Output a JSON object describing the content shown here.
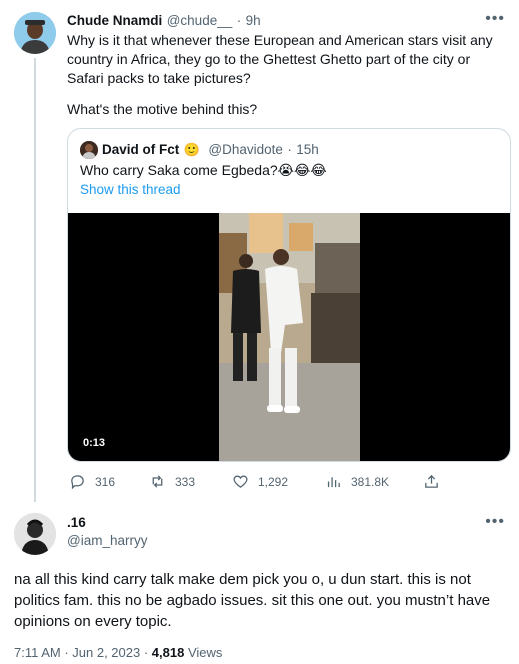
{
  "main_tweet": {
    "author_name": "Chude Nnamdi",
    "handle": "@chude__",
    "separator": "·",
    "time": "9h",
    "text": "Why is it that whenever these European and American stars visit any country in Africa, they go to the Ghettest Ghetto part of the city or Safari packs to take pictures?",
    "text2": "What's the motive behind this?",
    "more_icon": "more-dots-icon"
  },
  "quoted_tweet": {
    "author_name": "David of Fct",
    "author_emoji": "🙂",
    "handle": "@Dhavidote",
    "separator": "·",
    "time": "15h",
    "text": "Who carry Saka come Egbeda?😭😂😂",
    "show_thread": "Show this thread",
    "video_time": "0:13"
  },
  "actions": {
    "replies": "316",
    "retweets": "333",
    "likes": "1,292",
    "views": "381.8K"
  },
  "reply_tweet": {
    "author_name": ".16",
    "handle": "@iam_harryy",
    "text": "na all this kind carry talk make dem pick you o, u dun start. this is not politics fam. this no be agbado issues. sit this one out. you mustn’t have opinions on every topic.",
    "timestamp": "7:11 AM · Jun 2, 2023 ·",
    "views_count": "4,818",
    "views_label": "Views"
  },
  "colors": {
    "accent": "#1d9bf0",
    "muted": "#536471",
    "border": "#cfd9de"
  }
}
